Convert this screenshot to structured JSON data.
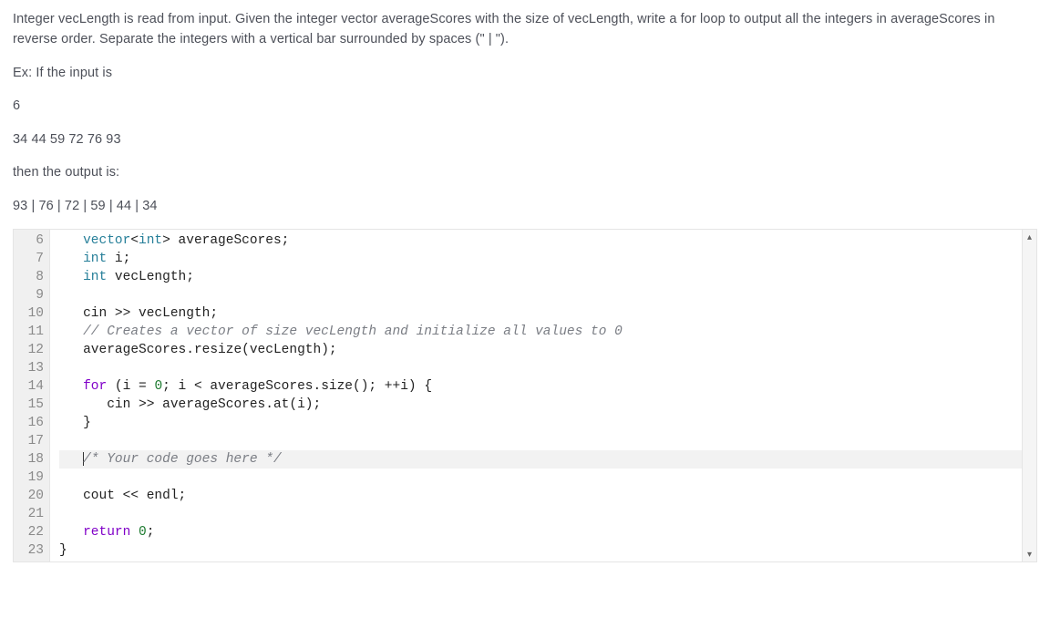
{
  "problem": {
    "para1": "Integer vecLength is read from input. Given the integer vector averageScores with the size of vecLength, write a for loop to output all the integers in averageScores in reverse order. Separate the integers with a vertical bar surrounded by spaces (\" | \").",
    "ex_label": "Ex: If the input is",
    "input_line1": "6",
    "input_line2": "34 44 59 72 76 93",
    "then_label": "then the output is:",
    "output_line": "93 | 76 | 72 | 59 | 44 | 34"
  },
  "editor": {
    "first_line_number": 6,
    "scroll_up_glyph": "▴",
    "scroll_down_glyph": "▾",
    "lines": [
      {
        "n": 6,
        "indent": 1,
        "tokens": [
          {
            "t": "vector",
            "c": "type"
          },
          {
            "t": "<",
            "c": "op"
          },
          {
            "t": "int",
            "c": "type"
          },
          {
            "t": "> ",
            "c": "op"
          },
          {
            "t": "averageScores",
            "c": "id"
          },
          {
            "t": ";",
            "c": "op"
          }
        ]
      },
      {
        "n": 7,
        "indent": 1,
        "tokens": [
          {
            "t": "int",
            "c": "type"
          },
          {
            "t": " ",
            "c": "op"
          },
          {
            "t": "i",
            "c": "id"
          },
          {
            "t": ";",
            "c": "op"
          }
        ]
      },
      {
        "n": 8,
        "indent": 1,
        "tokens": [
          {
            "t": "int",
            "c": "type"
          },
          {
            "t": " ",
            "c": "op"
          },
          {
            "t": "vecLength",
            "c": "id"
          },
          {
            "t": ";",
            "c": "op"
          }
        ]
      },
      {
        "n": 9,
        "indent": 0,
        "tokens": []
      },
      {
        "n": 10,
        "indent": 1,
        "tokens": [
          {
            "t": "cin",
            "c": "id"
          },
          {
            "t": " >> ",
            "c": "op"
          },
          {
            "t": "vecLength",
            "c": "id"
          },
          {
            "t": ";",
            "c": "op"
          }
        ]
      },
      {
        "n": 11,
        "indent": 1,
        "tokens": [
          {
            "t": "// Creates a vector of size vecLength and initialize all values to 0",
            "c": "comment"
          }
        ]
      },
      {
        "n": 12,
        "indent": 1,
        "tokens": [
          {
            "t": "averageScores",
            "c": "id"
          },
          {
            "t": ".",
            "c": "op"
          },
          {
            "t": "resize",
            "c": "func"
          },
          {
            "t": "(",
            "c": "op"
          },
          {
            "t": "vecLength",
            "c": "id"
          },
          {
            "t": ");",
            "c": "op"
          }
        ]
      },
      {
        "n": 13,
        "indent": 0,
        "tokens": []
      },
      {
        "n": 14,
        "indent": 1,
        "tokens": [
          {
            "t": "for",
            "c": "kw"
          },
          {
            "t": " (",
            "c": "op"
          },
          {
            "t": "i",
            "c": "id"
          },
          {
            "t": " = ",
            "c": "op"
          },
          {
            "t": "0",
            "c": "num"
          },
          {
            "t": "; ",
            "c": "op"
          },
          {
            "t": "i",
            "c": "id"
          },
          {
            "t": " < ",
            "c": "op"
          },
          {
            "t": "averageScores",
            "c": "id"
          },
          {
            "t": ".",
            "c": "op"
          },
          {
            "t": "size",
            "c": "func"
          },
          {
            "t": "(); ++",
            "c": "op"
          },
          {
            "t": "i",
            "c": "id"
          },
          {
            "t": ") {",
            "c": "op"
          }
        ]
      },
      {
        "n": 15,
        "indent": 2,
        "tokens": [
          {
            "t": "cin",
            "c": "id"
          },
          {
            "t": " >> ",
            "c": "op"
          },
          {
            "t": "averageScores",
            "c": "id"
          },
          {
            "t": ".",
            "c": "op"
          },
          {
            "t": "at",
            "c": "func"
          },
          {
            "t": "(",
            "c": "op"
          },
          {
            "t": "i",
            "c": "id"
          },
          {
            "t": ");",
            "c": "op"
          }
        ]
      },
      {
        "n": 16,
        "indent": 1,
        "tokens": [
          {
            "t": "}",
            "c": "op"
          }
        ]
      },
      {
        "n": 17,
        "indent": 0,
        "tokens": []
      },
      {
        "n": 18,
        "indent": 1,
        "highlight": true,
        "cursor_before": true,
        "tokens": [
          {
            "t": "/* Your code goes here */",
            "c": "comment"
          }
        ]
      },
      {
        "n": 19,
        "indent": 0,
        "tokens": []
      },
      {
        "n": 20,
        "indent": 1,
        "tokens": [
          {
            "t": "cout",
            "c": "id"
          },
          {
            "t": " << ",
            "c": "op"
          },
          {
            "t": "endl",
            "c": "id"
          },
          {
            "t": ";",
            "c": "op"
          }
        ]
      },
      {
        "n": 21,
        "indent": 0,
        "tokens": []
      },
      {
        "n": 22,
        "indent": 1,
        "tokens": [
          {
            "t": "return",
            "c": "kw"
          },
          {
            "t": " ",
            "c": "op"
          },
          {
            "t": "0",
            "c": "num"
          },
          {
            "t": ";",
            "c": "op"
          }
        ]
      },
      {
        "n": 23,
        "indent": 0,
        "tokens": [
          {
            "t": "}",
            "c": "op"
          }
        ]
      }
    ]
  }
}
